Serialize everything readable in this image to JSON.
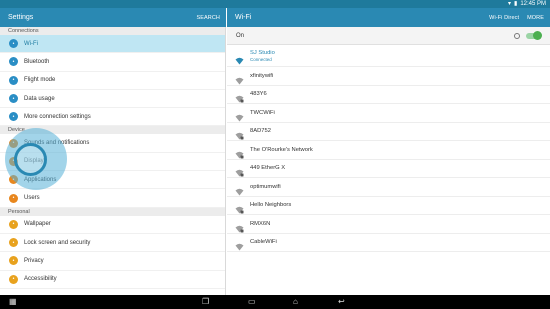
{
  "status_bar": {
    "time": "12:45 PM"
  },
  "left_header": {
    "title": "Settings",
    "search_label": "SEARCH"
  },
  "right_header": {
    "title": "Wi-Fi",
    "direct_label": "Wi-Fi Direct",
    "more_label": "MORE"
  },
  "sections": [
    {
      "header": "Connections",
      "items": [
        {
          "label": "Wi-Fi",
          "icon": "wifi-icon",
          "color": "#2a8ec5",
          "selected": true
        },
        {
          "label": "Bluetooth",
          "icon": "bluetooth-icon",
          "color": "#2a8ec5"
        },
        {
          "label": "Flight mode",
          "icon": "airplane-icon",
          "color": "#2a8ec5"
        },
        {
          "label": "Data usage",
          "icon": "data-usage-icon",
          "color": "#2a8ec5"
        },
        {
          "label": "More connection settings",
          "icon": "more-connections-icon",
          "color": "#2a8ec5"
        }
      ]
    },
    {
      "header": "Device",
      "items": [
        {
          "label": "Sounds and notifications",
          "icon": "sound-icon",
          "color": "#e8871e"
        },
        {
          "label": "Display",
          "icon": "display-icon",
          "color": "#e8871e"
        },
        {
          "label": "Applications",
          "icon": "apps-icon",
          "color": "#e8871e"
        },
        {
          "label": "Users",
          "icon": "users-icon",
          "color": "#e8871e"
        }
      ]
    },
    {
      "header": "Personal",
      "items": [
        {
          "label": "Wallpaper",
          "icon": "wallpaper-icon",
          "color": "#e8a21e"
        },
        {
          "label": "Lock screen and security",
          "icon": "lock-icon",
          "color": "#e8a21e"
        },
        {
          "label": "Privacy",
          "icon": "privacy-icon",
          "color": "#e8a21e"
        },
        {
          "label": "Accessibility",
          "icon": "accessibility-icon",
          "color": "#e8a21e"
        }
      ]
    }
  ],
  "wifi": {
    "on_label": "On",
    "toggle_on": true,
    "networks": [
      {
        "name": "SJ Studio",
        "status": "Connected",
        "locked": false
      },
      {
        "name": "xfinitywifi",
        "locked": false
      },
      {
        "name": "483Y6",
        "locked": true
      },
      {
        "name": "TWCWiFi",
        "locked": false
      },
      {
        "name": "8AD752",
        "locked": true
      },
      {
        "name": "The O'Rourke's Network",
        "locked": true
      },
      {
        "name": "449 EtherG X",
        "locked": true
      },
      {
        "name": "optimumwifi",
        "locked": false
      },
      {
        "name": "Hello Neighbors",
        "locked": true
      },
      {
        "name": "RMX6N",
        "locked": true
      },
      {
        "name": "CableWiFi",
        "locked": false
      }
    ]
  },
  "nav_bar": {
    "buttons": [
      "recent-apps-icon",
      "home-icon",
      "back-icon"
    ]
  }
}
